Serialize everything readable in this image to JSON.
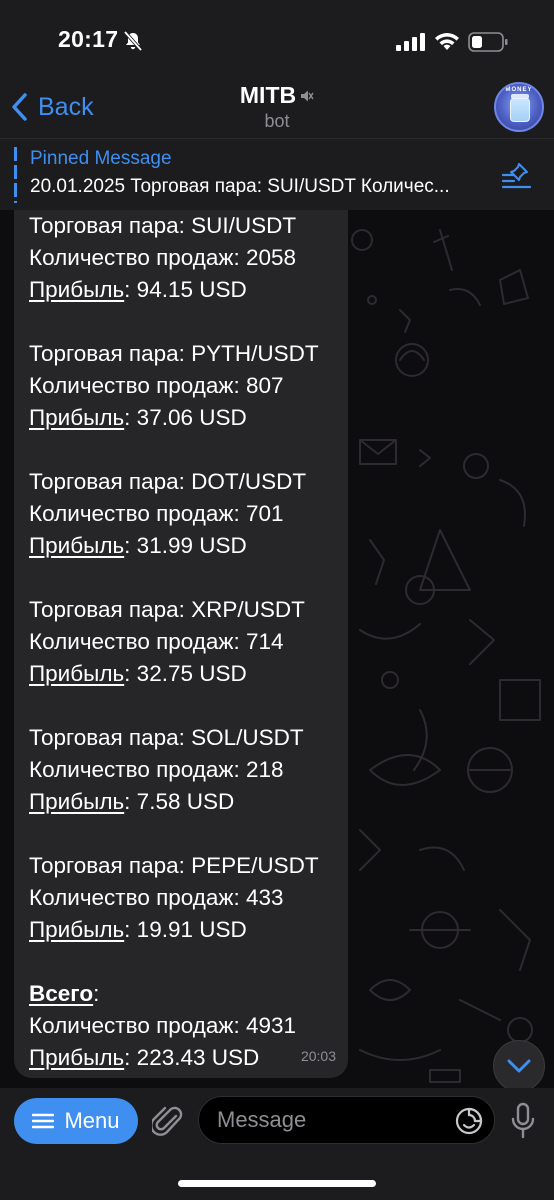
{
  "status_bar": {
    "time": "20:17"
  },
  "header": {
    "back_label": "Back",
    "title": "MITB",
    "subtitle": "bot",
    "avatar_text": "MONEY"
  },
  "pinned": {
    "title": "Pinned Message",
    "text": "20.01.2025 Торговая пара: SUI/USDT Количес..."
  },
  "message": {
    "pairs": [
      {
        "pair_line": "Торговая пара: SUI/USDT",
        "sales_line": "Количество продаж: 2058",
        "profit_label": "Прибыль",
        "profit_value": ": 94.15 USD"
      },
      {
        "pair_line": "Торговая пара: PYTH/USDT",
        "sales_line": "Количество продаж: 807",
        "profit_label": "Прибыль",
        "profit_value": ": 37.06 USD"
      },
      {
        "pair_line": "Торговая пара: DOT/USDT",
        "sales_line": "Количество продаж: 701",
        "profit_label": "Прибыль",
        "profit_value": ": 31.99 USD"
      },
      {
        "pair_line": "Торговая пара: XRP/USDT",
        "sales_line": "Количество продаж: 714",
        "profit_label": "Прибыль",
        "profit_value": ": 32.75 USD"
      },
      {
        "pair_line": "Торговая пара: SOL/USDT",
        "sales_line": "Количество продаж: 218",
        "profit_label": "Прибыль",
        "profit_value": ": 7.58 USD"
      },
      {
        "pair_line": "Торговая пара: PEPE/USDT",
        "sales_line": "Количество продаж: 433",
        "profit_label": "Прибыль",
        "profit_value": ": 19.91 USD"
      }
    ],
    "total": {
      "label": "Всего",
      "colon": ":",
      "sales_line": "Количество продаж: 4931",
      "profit_label": "Прибыль",
      "profit_value": ": 223.43 USD"
    },
    "time": "20:03"
  },
  "input_bar": {
    "menu_label": "Menu",
    "placeholder": "Message"
  },
  "colors": {
    "accent": "#3e8ff0",
    "bubble": "#262629",
    "bar": "#1c1c1e"
  }
}
